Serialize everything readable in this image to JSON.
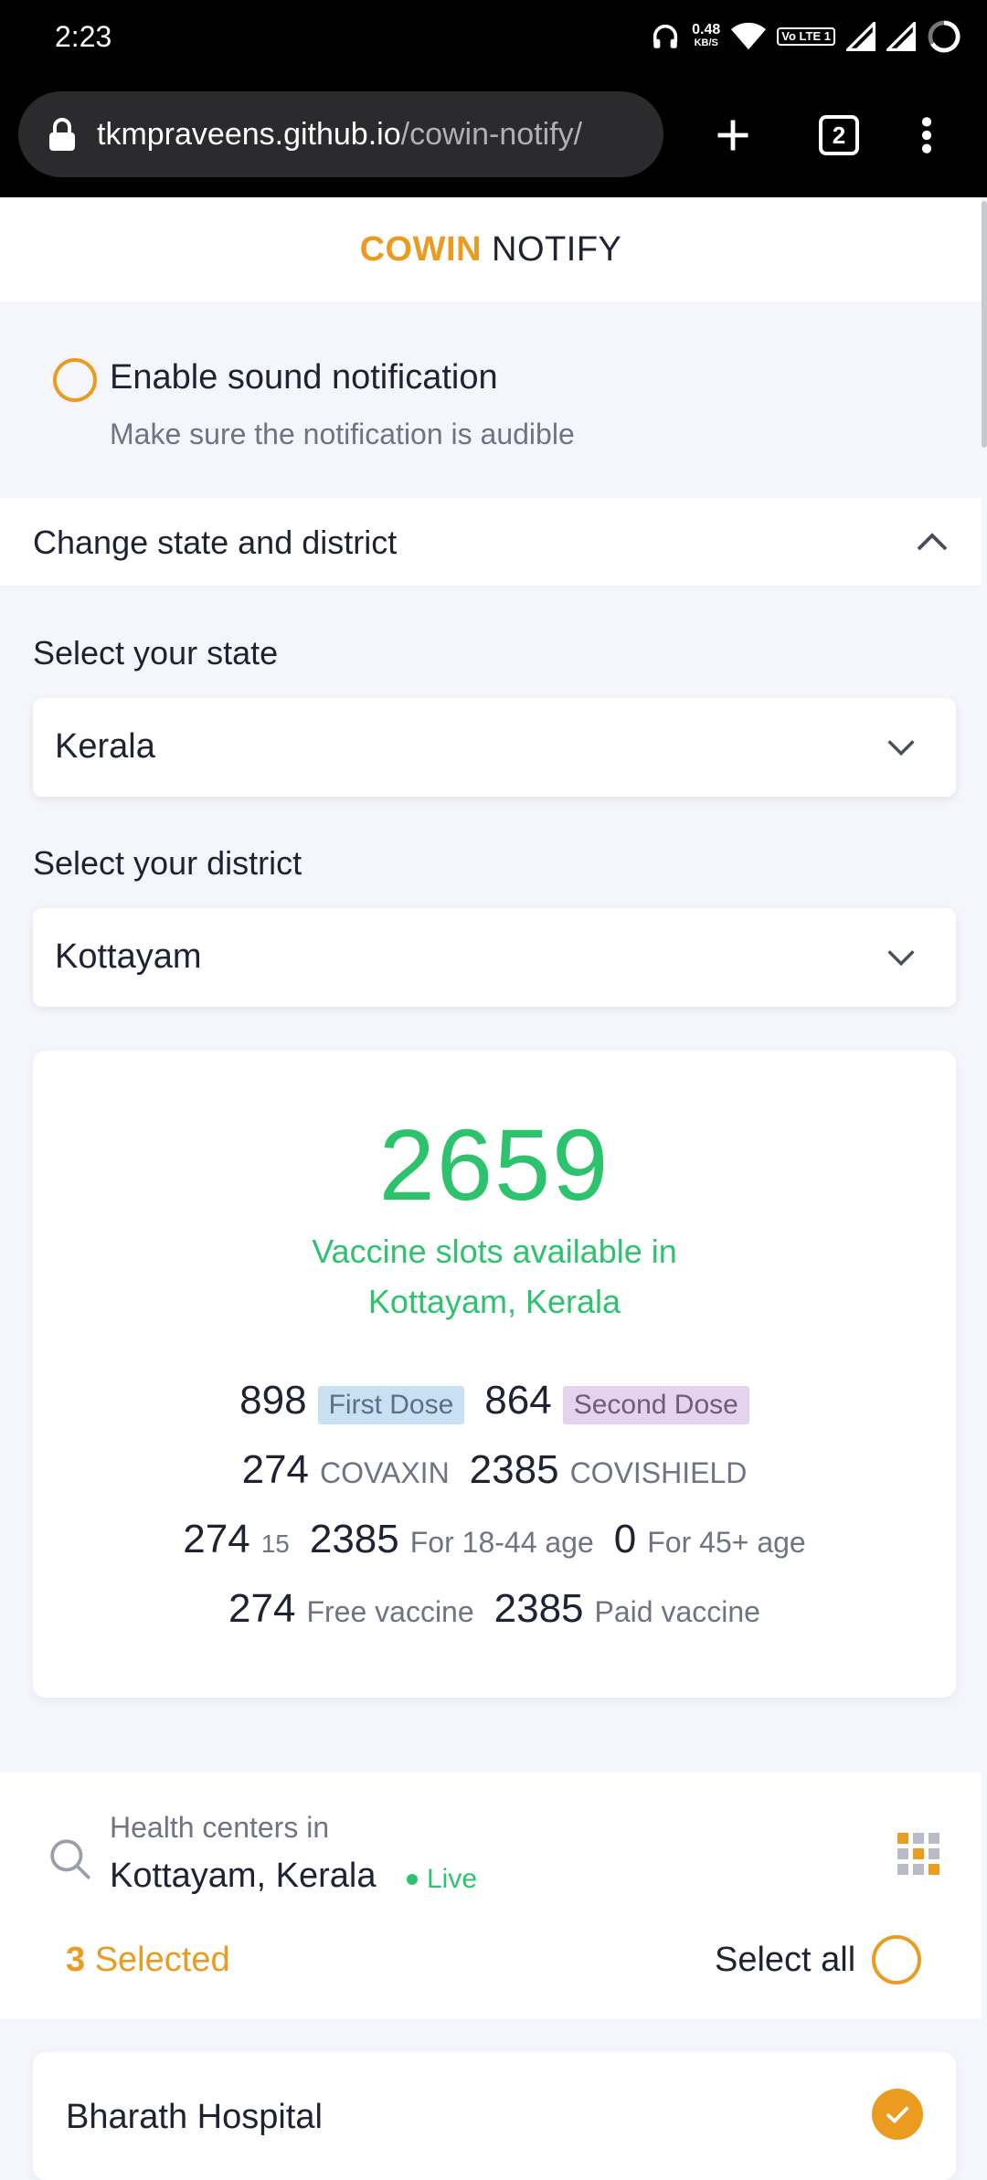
{
  "status_bar": {
    "time": "2:23",
    "speed_value": "0.48",
    "speed_unit": "KB/S",
    "volte_label": "Vo LTE 1"
  },
  "browser": {
    "url_host": "tkmpraveens.github.io",
    "url_path": "/cowin-notify/",
    "tab_count": "2"
  },
  "header": {
    "brand_primary": "COWIN",
    "brand_secondary": "NOTIFY"
  },
  "sound": {
    "title": "Enable sound notification",
    "subtitle": "Make sure the notification is audible"
  },
  "accordion": {
    "label": "Change state and district"
  },
  "state": {
    "label": "Select your state",
    "value": "Kerala"
  },
  "district": {
    "label": "Select your district",
    "value": "Kottayam"
  },
  "stats": {
    "total": "2659",
    "available_line1": "Vaccine slots available in",
    "available_line2": "Kottayam, Kerala",
    "first_dose": "898",
    "first_dose_label": "First Dose",
    "second_dose": "864",
    "second_dose_label": "Second Dose",
    "covaxin": "274",
    "covaxin_label": "COVAXIN",
    "covishield": "2385",
    "covishield_label": "COVISHIELD",
    "age15": "274",
    "age15_label": "15",
    "age18": "2385",
    "age18_label": "For 18-44 age",
    "age45": "0",
    "age45_label": "For 45+ age",
    "free": "274",
    "free_label": "Free vaccine",
    "paid": "2385",
    "paid_label": "Paid vaccine"
  },
  "health_centers": {
    "prefix": "Health centers in",
    "location": "Kottayam, Kerala",
    "live_label": "Live",
    "selected_count": "3",
    "selected_label": "Selected",
    "select_all": "Select all"
  },
  "hospital": {
    "name": "Bharath Hospital"
  },
  "colors": {
    "accent": "#ea9b20",
    "success": "#2dc36d",
    "background": "#f4f6fb"
  }
}
